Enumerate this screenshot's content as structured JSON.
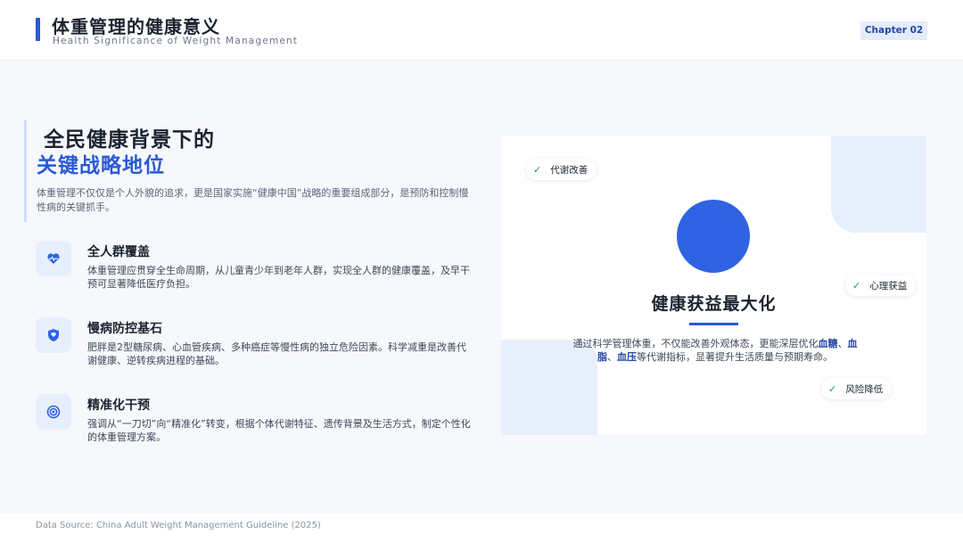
{
  "header": {
    "title": "体重管理的健康意义",
    "subtitle": "Health Significance of Weight Management",
    "chapter": "Chapter 02"
  },
  "intro": {
    "title_line1": "全民健康背景下的",
    "title_line2": "关键战略地位",
    "description": "体重管理不仅仅是个人外貌的追求，更是国家实施“健康中国”战略的重要组成部分，是预防和控制慢性病的关键抓手。"
  },
  "features": [
    {
      "title": "全人群覆盖",
      "description": "体重管理应贯穿全生命周期，从儿童青少年到老年人群，实现全人群的健康覆盖，及早干预可显著降低医疗负担。",
      "icon": "heart-pulse-icon"
    },
    {
      "title": "慢病防控基石",
      "description": "肥胖是2型糖尿病、心血管疾病、多种癌症等慢性病的独立危险因素。科学减重是改善代谢健康、逆转疾病进程的基础。",
      "icon": "shield-icon"
    },
    {
      "title": "精准化干预",
      "description": "强调从“一刀切”向“精准化”转变，根据个体代谢特征、遗传背景及生活方式，制定个性化的体重管理方案。",
      "icon": "target-icon"
    }
  ],
  "card": {
    "title": "健康获益最大化",
    "desc_pre": "通过科学管理体重，不仅能改善外观体态，更能深层优化",
    "desc_hl1": "血糖",
    "desc_sep": "、",
    "desc_hl2": "血脂",
    "desc_hl3": "血压",
    "desc_post": "等代谢指标，显著提升生活质量与预期寿命。",
    "tags": {
      "metabolism": "代谢改善",
      "mental": "心理获益",
      "risk": "风险降低"
    },
    "colors": {
      "accent": "#2f63e3",
      "check": "#1e9a55"
    }
  },
  "footer": {
    "source": "Data Source: China Adult Weight Management Guideline (2025)"
  }
}
